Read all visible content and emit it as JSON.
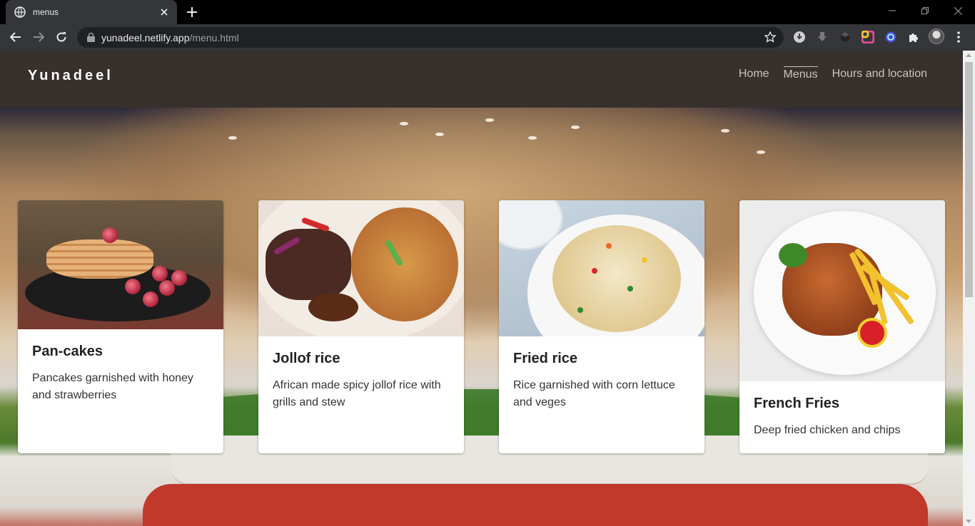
{
  "browser": {
    "tab_title": "menus",
    "url_host": "yunadeel.netlify.app",
    "url_path": "/menu.html"
  },
  "site": {
    "brand": "Yunadeel",
    "nav": [
      {
        "label": "Home",
        "active": false
      },
      {
        "label": "Menus",
        "active": true
      },
      {
        "label": "Hours and location",
        "active": false
      }
    ]
  },
  "menu": [
    {
      "title": "Pan-cakes",
      "description": "Pancakes garnished with honey and strawberries"
    },
    {
      "title": "Jollof rice",
      "description": "African made spicy jollof rice with grills and stew"
    },
    {
      "title": "Fried rice",
      "description": "Rice garnished with corn lettuce and veges"
    },
    {
      "title": "French Fries",
      "description": "Deep fried chicken and chips"
    }
  ],
  "colors": {
    "header_bg": "#37302c",
    "nav_text": "#c9c4c0",
    "card_bg": "#ffffff"
  }
}
